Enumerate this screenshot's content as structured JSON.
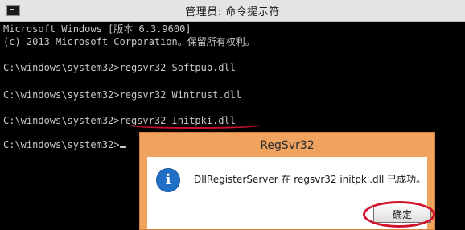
{
  "window": {
    "title": "管理员: 命令提示符"
  },
  "console": {
    "lines": [
      "Microsoft Windows [版本 6.3.9600]",
      "(c) 2013 Microsoft Corporation。保留所有权利。",
      "",
      "C:\\windows\\system32>regsvr32 Softpub.dll",
      "",
      "C:\\windows\\system32>regsvr32 Wintrust.dll",
      "",
      "C:\\windows\\system32>regsvr32 Initpki.dll",
      "",
      "C:\\windows\\system32>"
    ]
  },
  "dialog": {
    "title": "RegSvr32",
    "message": "DllRegisterServer 在 regsvr32 initpki.dll 已成功。",
    "ok_label": "确定",
    "icon": "info-icon"
  },
  "colors": {
    "console_bg": "#000000",
    "console_text": "#c8c8c8",
    "dialog_frame": "#f0a35e",
    "annotation_red": "#c8102e",
    "info_blue": "#1f6fc6"
  }
}
